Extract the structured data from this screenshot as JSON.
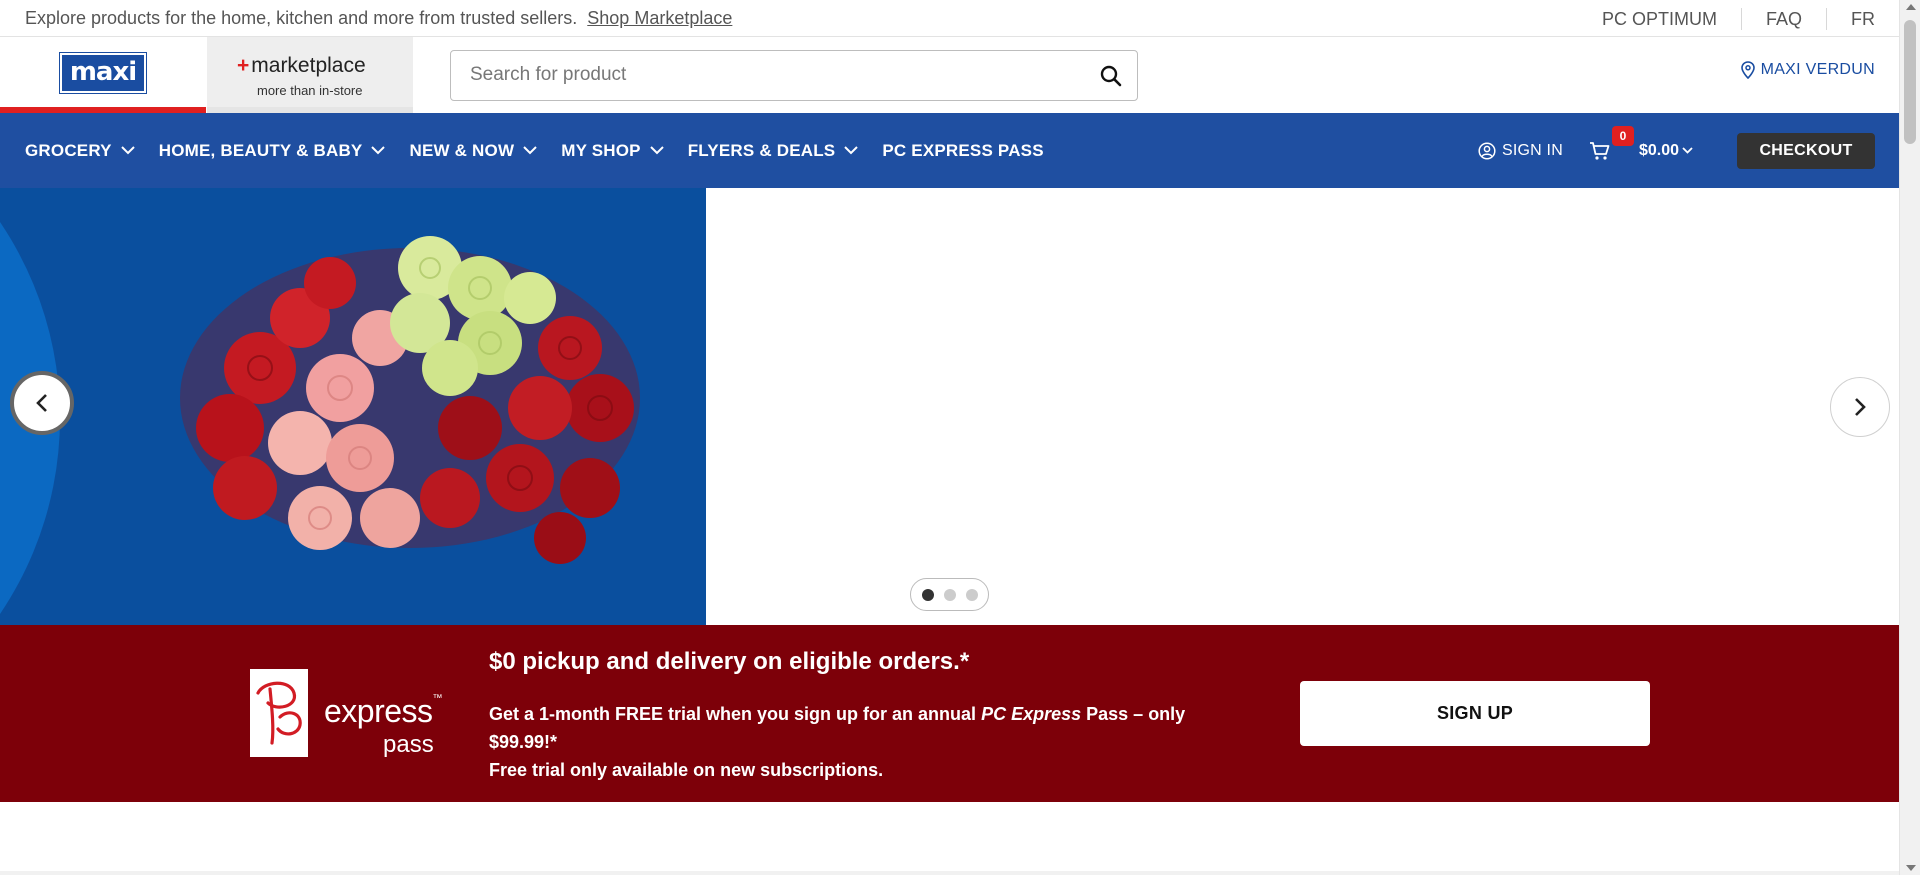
{
  "topbar": {
    "promo_text": "Explore products for the home, kitchen and more from trusted sellers.",
    "promo_link": "Shop Marketplace",
    "links": [
      "PC OPTIMUM",
      "FAQ",
      "FR"
    ]
  },
  "header": {
    "logo": "maxi",
    "marketplace_title": "marketplace",
    "marketplace_sub": "more than in-store",
    "search_placeholder": "Search for product",
    "store_name": "MAXI VERDUN"
  },
  "nav": {
    "items": [
      {
        "label": "GROCERY",
        "dropdown": true
      },
      {
        "label": "HOME, BEAUTY & BABY",
        "dropdown": true
      },
      {
        "label": "NEW & NOW",
        "dropdown": true
      },
      {
        "label": "MY SHOP",
        "dropdown": true
      },
      {
        "label": "FLYERS & DEALS",
        "dropdown": true
      },
      {
        "label": "PC EXPRESS PASS",
        "dropdown": false
      }
    ],
    "sign_in": "SIGN IN",
    "cart_count": "0",
    "cart_total": "$0.00",
    "checkout": "CHECKOUT"
  },
  "hero": {
    "slide_count": 3,
    "active_slide": 1
  },
  "pass_banner": {
    "logo_word": "express",
    "logo_sub": "pass",
    "headline": "$0 pickup and delivery on eligible orders.*",
    "text_part1": "Get a 1-month FREE trial when you sign up for an annual",
    "text_em": "PC Express",
    "text_part2": "Pass – only $99.99!*",
    "text_line2": "Free trial only available on new subscriptions.",
    "button": "SIGN UP"
  },
  "colors": {
    "brand_blue": "#1f4fa1",
    "accent_red": "#e02020",
    "banner_red": "#7d0009",
    "hero_blue": "#0a4f9e"
  }
}
